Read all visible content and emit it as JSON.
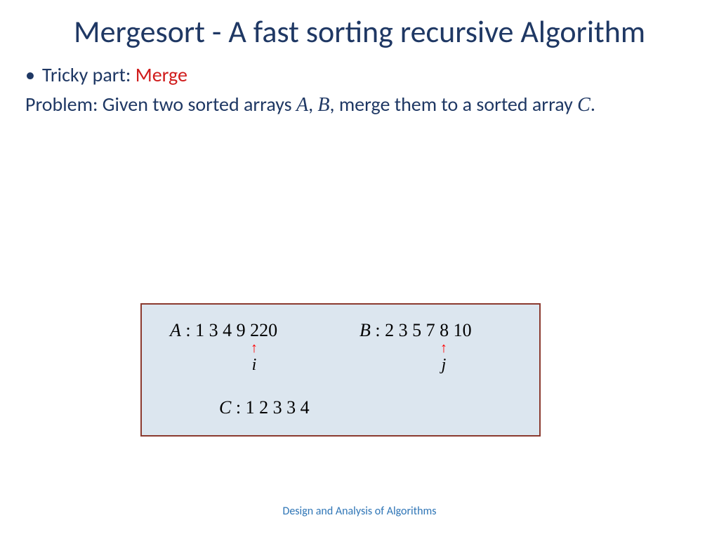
{
  "title": "Mergesort - A fast sorting recursive Algorithm",
  "bullet": {
    "prefix": "Tricky part: ",
    "highlight": "Merge"
  },
  "problem": {
    "p1": "Problem: Given two sorted arrays ",
    "varA": "A",
    "sep1": ", ",
    "varB": "B",
    "p2": ", merge them to a sorted array ",
    "varC": "C",
    "p3": "."
  },
  "arrays": {
    "A": {
      "label": "A",
      "values": "1 3 4 9 220"
    },
    "B": {
      "label": "B",
      "values": "2 3 5 7 8 10"
    },
    "C": {
      "label": "C",
      "values": "1 2 3 3 4"
    }
  },
  "pointers": {
    "i": "i",
    "j": "j"
  },
  "footer": "Design and Analysis of Algorithms"
}
